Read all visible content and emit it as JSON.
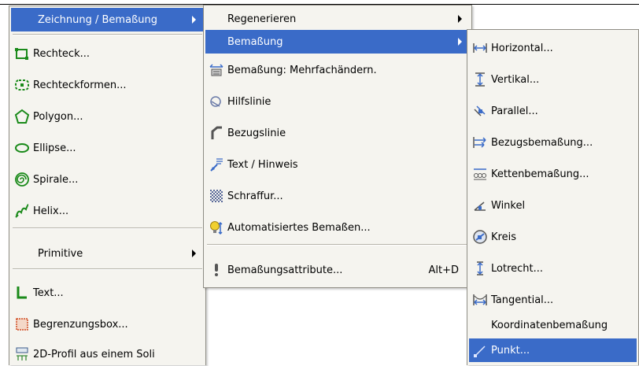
{
  "menu1": {
    "header": "Zeichnung / Bemaßung",
    "items": [
      "Rechteck...",
      "Rechteckformen...",
      "Polygon...",
      "Ellipse...",
      "Spirale...",
      "Helix...",
      "Primitive",
      "Text...",
      "Begrenzungsbox...",
      "2D-Profil aus einem Soli"
    ]
  },
  "menu2": {
    "items": [
      {
        "label": "Regenerieren",
        "shortcut": ""
      },
      {
        "label": "Bemaßung",
        "shortcut": ""
      },
      {
        "label": "Bemaßung: Mehrfachändern.",
        "shortcut": ""
      },
      {
        "label": "Hilfslinie",
        "shortcut": ""
      },
      {
        "label": "Bezugslinie",
        "shortcut": ""
      },
      {
        "label": "Text / Hinweis",
        "shortcut": ""
      },
      {
        "label": "Schraffur...",
        "shortcut": ""
      },
      {
        "label": "Automatisiertes Bemaßen...",
        "shortcut": ""
      },
      {
        "label": "Bemaßungsattribute...",
        "shortcut": "Alt+D"
      }
    ]
  },
  "menu3": {
    "items": [
      "Horizontal...",
      "Vertikal...",
      "Parallel...",
      "Bezugsbemaßung...",
      "Kettenbemaßung...",
      "Winkel",
      "Kreis",
      "Lotrecht...",
      "Tangential...",
      "Koordinatenbemaßung",
      "Punkt..."
    ]
  },
  "colors": {
    "highlight": "#3a6bc8",
    "menu_bg": "#f5f4ef"
  }
}
